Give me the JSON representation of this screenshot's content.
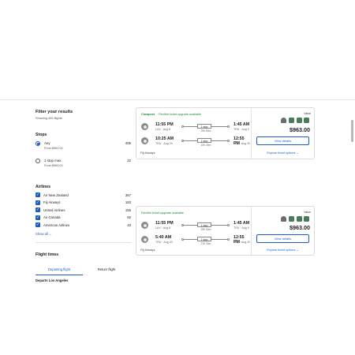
{
  "sidebar": {
    "title": "Filter your results",
    "subtitle": "Showing 405 flights",
    "stops": {
      "heading": "Stops",
      "options": [
        {
          "label": "Any",
          "from": "From $963.00",
          "count": "405",
          "selected": true
        },
        {
          "label": "1 stop max",
          "from": "From $963.00",
          "count": "22",
          "selected": false
        }
      ]
    },
    "airlines": {
      "heading": "Airlines",
      "items": [
        {
          "label": "Air New Zealand",
          "count": "367"
        },
        {
          "label": "Fiji Airways",
          "count": "183"
        },
        {
          "label": "United Airlines",
          "count": "155"
        },
        {
          "label": "Air Canada",
          "count": "92"
        },
        {
          "label": "American Airlines",
          "count": "40"
        }
      ],
      "show_all": "Show all"
    },
    "flight_times": {
      "heading": "Flight times",
      "tabs": [
        "Departing flight",
        "Return flight"
      ],
      "departs": "Departs Los Angeles"
    }
  },
  "cards": [
    {
      "tags": [
        "Cheapest",
        "Flexible ticket upgrade available"
      ],
      "legs": [
        {
          "dep_time": "11:55 PM",
          "dep_sub": "LAX · Aug 8",
          "stops": "1 stop",
          "duration": "29h 50m",
          "arr_time": "1:45 AM",
          "arr_sub": "TRU · Aug 9"
        },
        {
          "dep_time": "10:25 AM",
          "dep_sub": "TRU · Aug 20",
          "stops": "1 stop",
          "duration": "22h 30m",
          "arr_time": "12:55 PM",
          "arr_sub": "LAX · Aug 20"
        }
      ],
      "airline": "Fiji Airways",
      "value_label": "Value",
      "price": "$963.00",
      "view_details": "View details",
      "explore": "Explore ticket options"
    },
    {
      "tags": [
        "Flexible ticket upgrade available"
      ],
      "legs": [
        {
          "dep_time": "11:55 PM",
          "dep_sub": "LAX · Aug 8",
          "stops": "1 stop",
          "duration": "29h 50m",
          "arr_time": "1:45 AM",
          "arr_sub": "TRU · Aug 9"
        },
        {
          "dep_time": "5:40 AM",
          "dep_sub": "TRU · Aug 20",
          "stops": "1 stop",
          "duration": "27h 15m",
          "arr_time": "12:55 PM",
          "arr_sub": "LAX · Aug 20"
        }
      ],
      "airline": "Fiji Airways",
      "value_label": "Value",
      "price": "$963.00",
      "view_details": "View details",
      "explore": "Explore ticket options"
    }
  ],
  "icons": {
    "airline_logo": "airline-logo-icon",
    "bag": "baggage-icon",
    "chevron": "chevron-down-icon",
    "check": "checkmark-icon"
  },
  "colors": {
    "accent": "#1a5ccf",
    "green_tag": "#1b8a3a"
  }
}
